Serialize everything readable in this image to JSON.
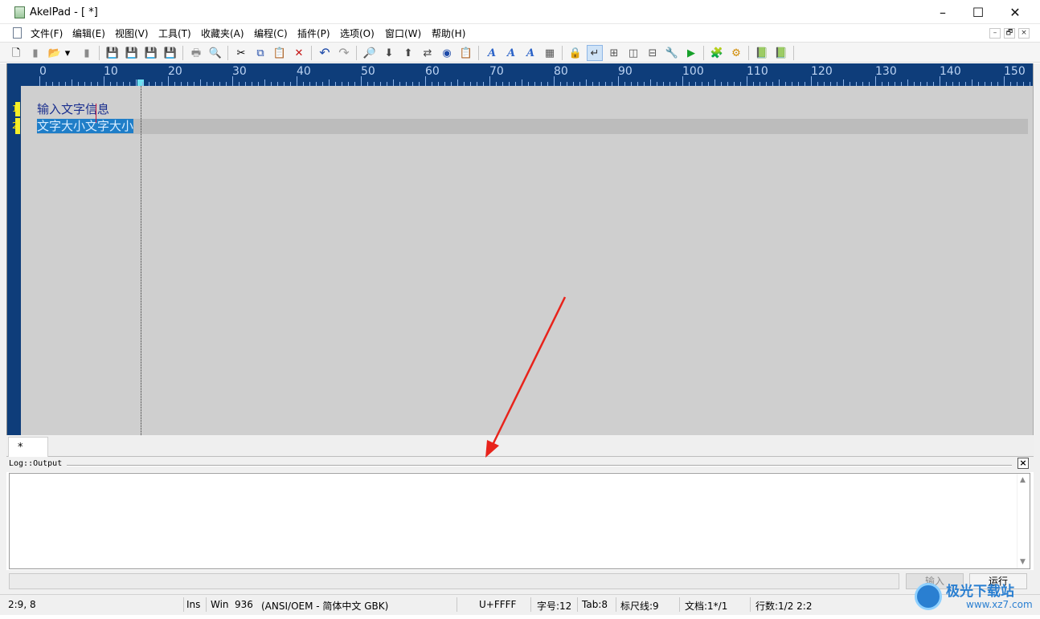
{
  "window": {
    "title": "AkelPad - [ *]",
    "minimize": "–",
    "maximize": "☐",
    "close": "✕"
  },
  "menu": {
    "items": [
      "文件(F)",
      "编辑(E)",
      "视图(V)",
      "工具(T)",
      "收藏夹(A)",
      "编程(C)",
      "插件(P)",
      "选项(O)",
      "窗口(W)",
      "帮助(H)"
    ],
    "mdi_buttons": [
      "–",
      "🗗",
      "×"
    ]
  },
  "toolbar": {
    "buttons": [
      {
        "name": "new-file",
        "glyph": "🗋"
      },
      {
        "name": "new-window",
        "glyph": "▮"
      },
      {
        "name": "open",
        "glyph": "📂"
      },
      {
        "name": "open-dropdown",
        "glyph": "▾"
      },
      {
        "name": "reopen",
        "glyph": "▮"
      },
      {
        "name": "save",
        "glyph": "💾"
      },
      {
        "name": "save-as",
        "glyph": "💾"
      },
      {
        "name": "save-all",
        "glyph": "💾"
      },
      {
        "name": "save-session",
        "glyph": "💾"
      },
      {
        "name": "print",
        "glyph": "🖶"
      },
      {
        "name": "print-preview",
        "glyph": "🔍"
      },
      {
        "name": "cut",
        "glyph": "✂"
      },
      {
        "name": "copy",
        "glyph": "⧉"
      },
      {
        "name": "paste",
        "glyph": "📋"
      },
      {
        "name": "delete",
        "glyph": "✕"
      },
      {
        "name": "undo",
        "glyph": "↶"
      },
      {
        "name": "redo",
        "glyph": "↷"
      },
      {
        "name": "find",
        "glyph": "🔎"
      },
      {
        "name": "find-next",
        "glyph": "⬇"
      },
      {
        "name": "find-previous",
        "glyph": "⬆"
      },
      {
        "name": "replace",
        "glyph": "⇄"
      },
      {
        "name": "go-to",
        "glyph": "◉"
      },
      {
        "name": "clipboard",
        "glyph": "📋"
      },
      {
        "name": "font",
        "glyph": "A"
      },
      {
        "name": "font-larger",
        "glyph": "A"
      },
      {
        "name": "font-smaller",
        "glyph": "A"
      },
      {
        "name": "color-scheme",
        "glyph": "▦"
      },
      {
        "name": "read-only",
        "glyph": "🔒"
      },
      {
        "name": "word-wrap",
        "glyph": "↵"
      },
      {
        "name": "split-window",
        "glyph": "⊞"
      },
      {
        "name": "split-vertical",
        "glyph": "◫"
      },
      {
        "name": "split-horizontal",
        "glyph": "⊟"
      },
      {
        "name": "settings",
        "glyph": "🔧"
      },
      {
        "name": "run",
        "glyph": "▶"
      },
      {
        "name": "plugins",
        "glyph": "🧩"
      },
      {
        "name": "options",
        "glyph": "⚙"
      },
      {
        "name": "notes",
        "glyph": "📗"
      },
      {
        "name": "scripts",
        "glyph": "📗"
      }
    ]
  },
  "ruler": {
    "labels": [
      "0",
      "10",
      "20",
      "30",
      "40",
      "50",
      "60",
      "70",
      "80",
      "90",
      "100",
      "110",
      "120",
      "130",
      "140",
      "150"
    ]
  },
  "editor": {
    "lines": [
      {
        "number": "1",
        "text": "输入文字信息",
        "selected": false
      },
      {
        "number": "2",
        "text": "文字大小文字大小",
        "selected": true
      }
    ]
  },
  "tabs": [
    {
      "label": "*"
    }
  ],
  "log": {
    "title": "Log::Output",
    "close": "×",
    "output": ""
  },
  "command": {
    "input_value": "",
    "input_button": "输入",
    "run_button": "运行"
  },
  "status": {
    "position": "2:9, 8",
    "insert_mode": "Ins",
    "newline": "Win",
    "codepage": "936",
    "encoding": "(ANSI/OEM - 简体中文 GBK)",
    "char_code": "U+FFFF",
    "font_size": "字号:12",
    "tab_size": "Tab:8",
    "ruler_line": "标尺线:9",
    "document": "文档:1*/1",
    "lines": "行数:1/2 2:2"
  },
  "watermark": {
    "title": "极光下载站",
    "url": "www.xz7.com"
  },
  "colors": {
    "ruler_bg": "#0e3d7a",
    "editor_bg": "#cfcfcf",
    "selection": "#1f7ec8",
    "annotation_arrow": "#e8231b"
  }
}
